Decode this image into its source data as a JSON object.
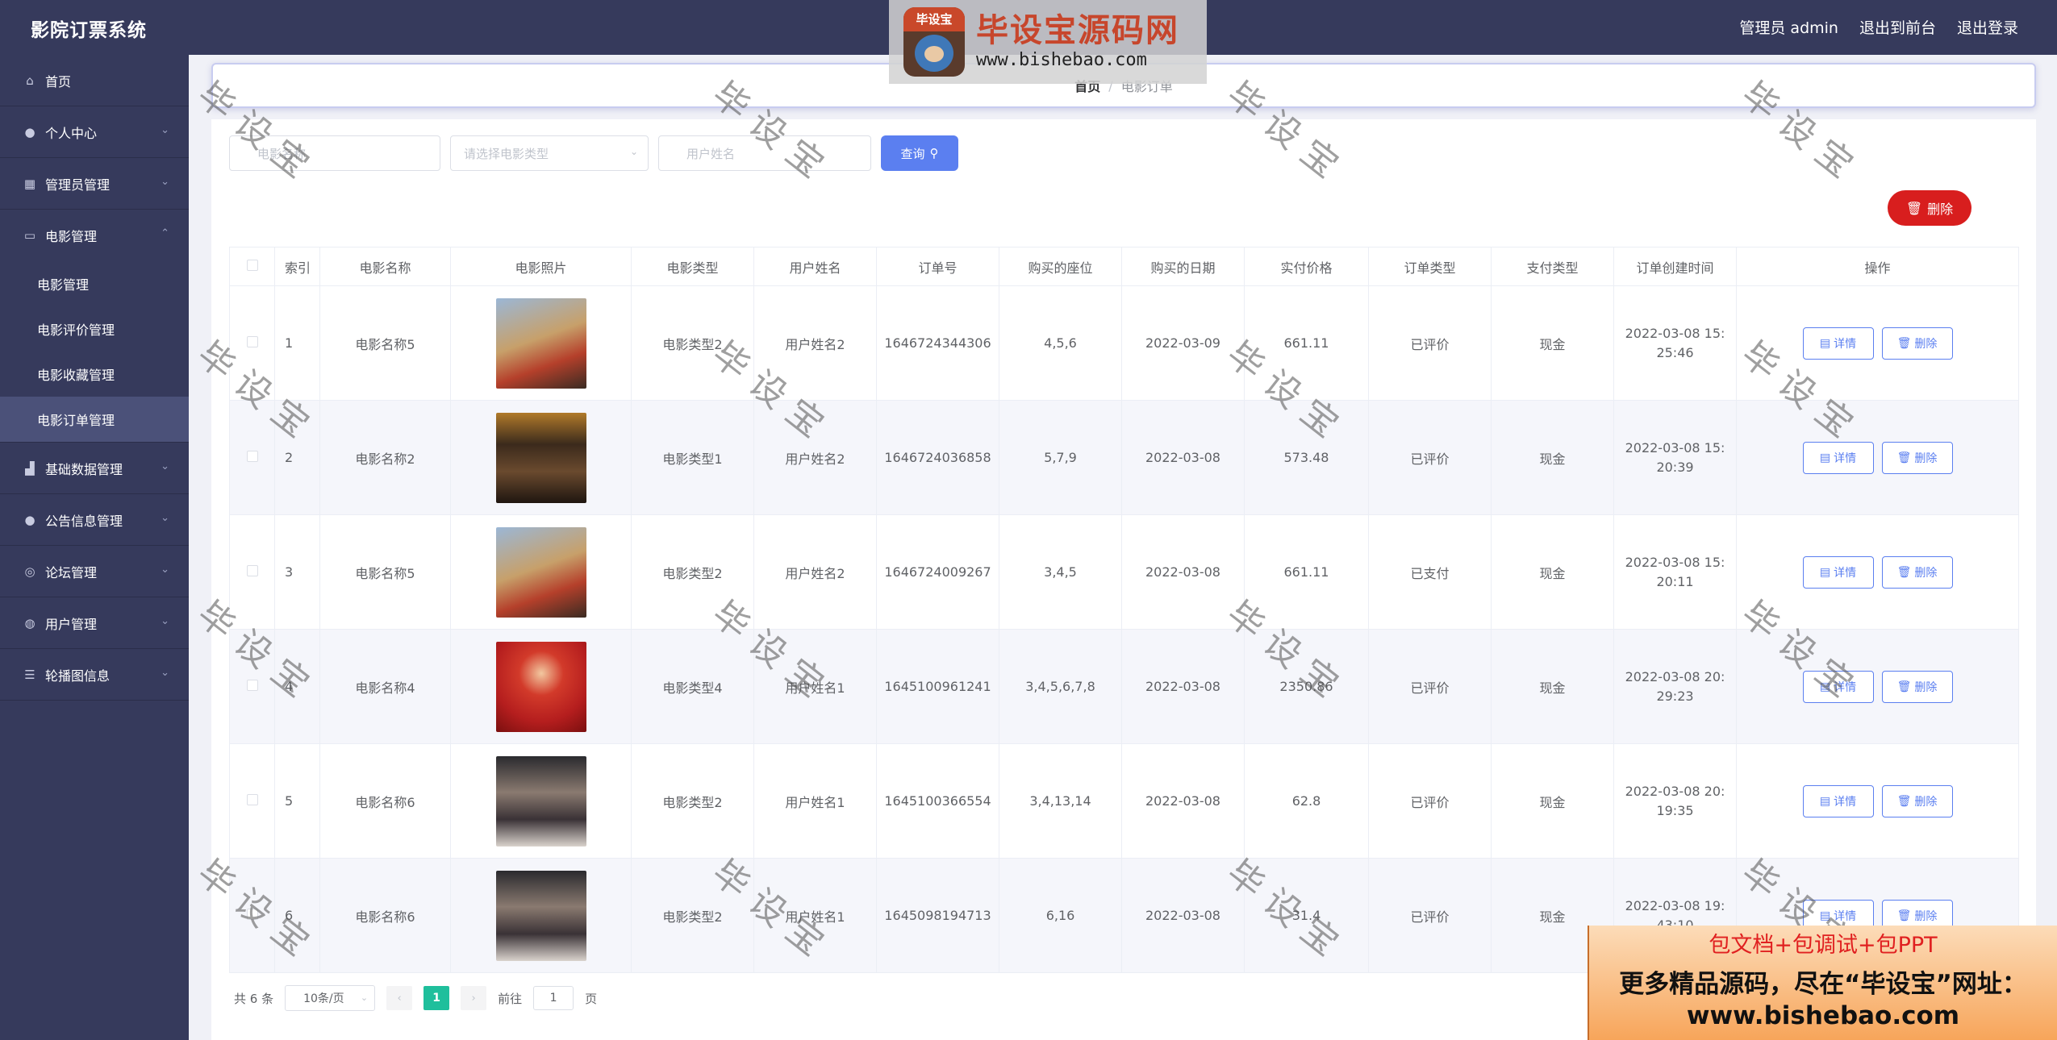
{
  "app": {
    "title": "影院订票系统"
  },
  "topbar": {
    "user": "管理员 admin",
    "front": "退出到前台",
    "logout": "退出登录"
  },
  "logo": {
    "badge": "毕设宝",
    "title": "毕设宝源码网",
    "url": "www.bishebao.com"
  },
  "sidebar": {
    "home": "首页",
    "items": [
      {
        "label": "个人中心"
      },
      {
        "label": "管理员管理"
      },
      {
        "label": "电影管理"
      }
    ],
    "sub_items": [
      {
        "label": "电影管理"
      },
      {
        "label": "电影评价管理"
      },
      {
        "label": "电影收藏管理"
      },
      {
        "label": "电影订单管理"
      }
    ],
    "more_items": [
      {
        "label": "基础数据管理"
      },
      {
        "label": "公告信息管理"
      },
      {
        "label": "论坛管理"
      },
      {
        "label": "用户管理"
      },
      {
        "label": "轮播图信息"
      }
    ]
  },
  "breadcrumb": {
    "home": "首页",
    "sep": "/",
    "current": "电影订单"
  },
  "search": {
    "name_placeholder": "电影名称",
    "type_placeholder": "请选择电影类型",
    "user_placeholder": "用户姓名",
    "query_label": "查询"
  },
  "actions": {
    "delete_label": "删除"
  },
  "table": {
    "headers": [
      "索引",
      "电影名称",
      "电影照片",
      "电影类型",
      "用户姓名",
      "订单号",
      "购买的座位",
      "购买的日期",
      "实付价格",
      "订单类型",
      "支付类型",
      "订单创建时间",
      "操作"
    ],
    "detail_label": "详情",
    "delete_label": "删除",
    "rows": [
      {
        "idx": "1",
        "name": "电影名称5",
        "type": "电影类型2",
        "user": "用户姓名2",
        "order": "1646724344306",
        "seats": "4,5,6",
        "date": "2022-03-09",
        "price": "661.11",
        "status": "已评价",
        "pay": "现金",
        "time": "2022-03-08 15:25:46"
      },
      {
        "idx": "2",
        "name": "电影名称2",
        "type": "电影类型1",
        "user": "用户姓名2",
        "order": "1646724036858",
        "seats": "5,7,9",
        "date": "2022-03-08",
        "price": "573.48",
        "status": "已评价",
        "pay": "现金",
        "time": "2022-03-08 15:20:39"
      },
      {
        "idx": "3",
        "name": "电影名称5",
        "type": "电影类型2",
        "user": "用户姓名2",
        "order": "1646724009267",
        "seats": "3,4,5",
        "date": "2022-03-08",
        "price": "661.11",
        "status": "已支付",
        "pay": "现金",
        "time": "2022-03-08 15:20:11"
      },
      {
        "idx": "4",
        "name": "电影名称4",
        "type": "电影类型4",
        "user": "用户姓名1",
        "order": "1645100961241",
        "seats": "3,4,5,6,7,8",
        "date": "2022-03-08",
        "price": "2350.86",
        "status": "已评价",
        "pay": "现金",
        "time": "2022-03-08 20:29:23"
      },
      {
        "idx": "5",
        "name": "电影名称6",
        "type": "电影类型2",
        "user": "用户姓名1",
        "order": "1645100366554",
        "seats": "3,4,13,14",
        "date": "2022-03-08",
        "price": "62.8",
        "status": "已评价",
        "pay": "现金",
        "time": "2022-03-08 20:19:35"
      },
      {
        "idx": "6",
        "name": "电影名称6",
        "type": "电影类型2",
        "user": "用户姓名1",
        "order": "1645098194713",
        "seats": "6,16",
        "date": "2022-03-08",
        "price": "31.4",
        "status": "已评价",
        "pay": "现金",
        "time": "2022-03-08 19:43:10"
      }
    ]
  },
  "pager": {
    "total": "共 6 条",
    "size": "10条/页",
    "page": "1",
    "goto": "前往",
    "goto_value": "1",
    "page_unit": "页"
  },
  "promo": {
    "line1": "包文档+包调试+包PPT",
    "line2": "更多精品源码，尽在“毕设宝”网址：",
    "line3": "www.bishebao.com"
  },
  "watermark": "毕设宝",
  "colors": {
    "sidebar": "#363a5c",
    "primary": "#5b7ff0",
    "danger": "#d81e1e",
    "pager_active": "#1fbf9c"
  }
}
